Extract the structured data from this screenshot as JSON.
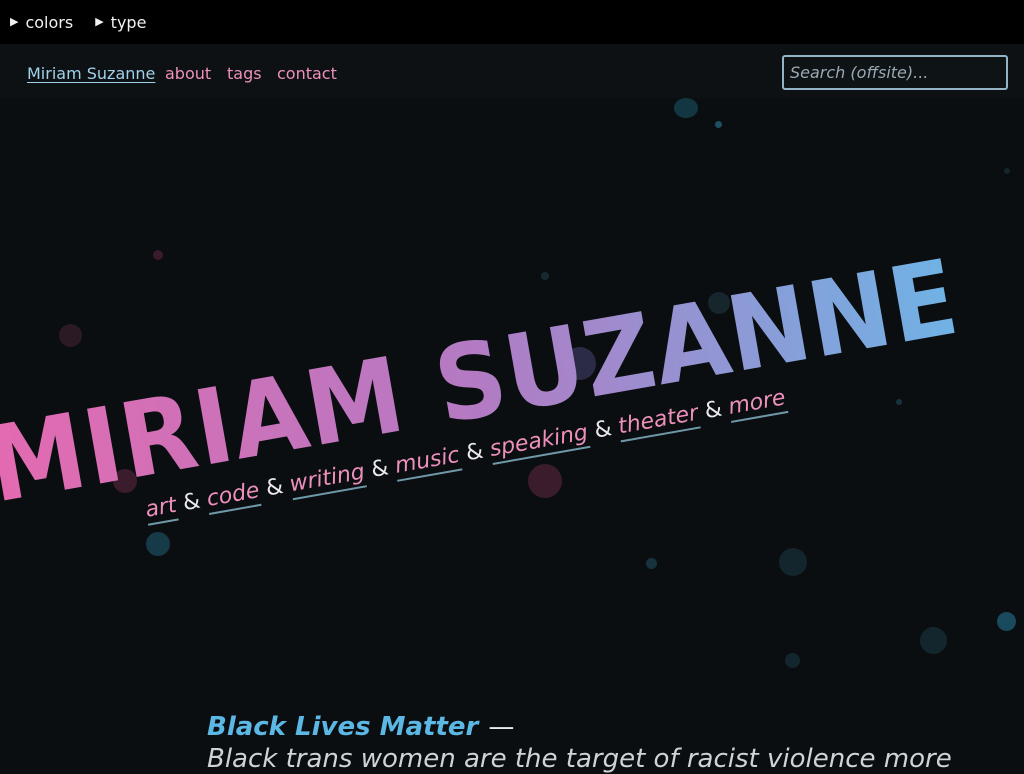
{
  "topbar": {
    "colors_label": "colors",
    "type_label": "type"
  },
  "nav": {
    "home_label": "Miriam Suzanne",
    "about_label": "about",
    "tags_label": "tags",
    "contact_label": "contact",
    "search_placeholder": "Search (offsite)..."
  },
  "hero": {
    "title": "MIRIAM SUZANNE",
    "links": [
      "art",
      "code",
      "writing",
      "music",
      "speaking",
      "theater",
      "more"
    ],
    "separator": "&"
  },
  "blm": {
    "heading": "Black Lives Matter",
    "dash": "—",
    "text": "Black trans women are the target of racist violence more"
  },
  "colors": {
    "background": "#0b0e10",
    "link_pink": "#ee90bd",
    "link_blue": "#9fd1ea",
    "blm_blue": "#5bb7e3"
  }
}
